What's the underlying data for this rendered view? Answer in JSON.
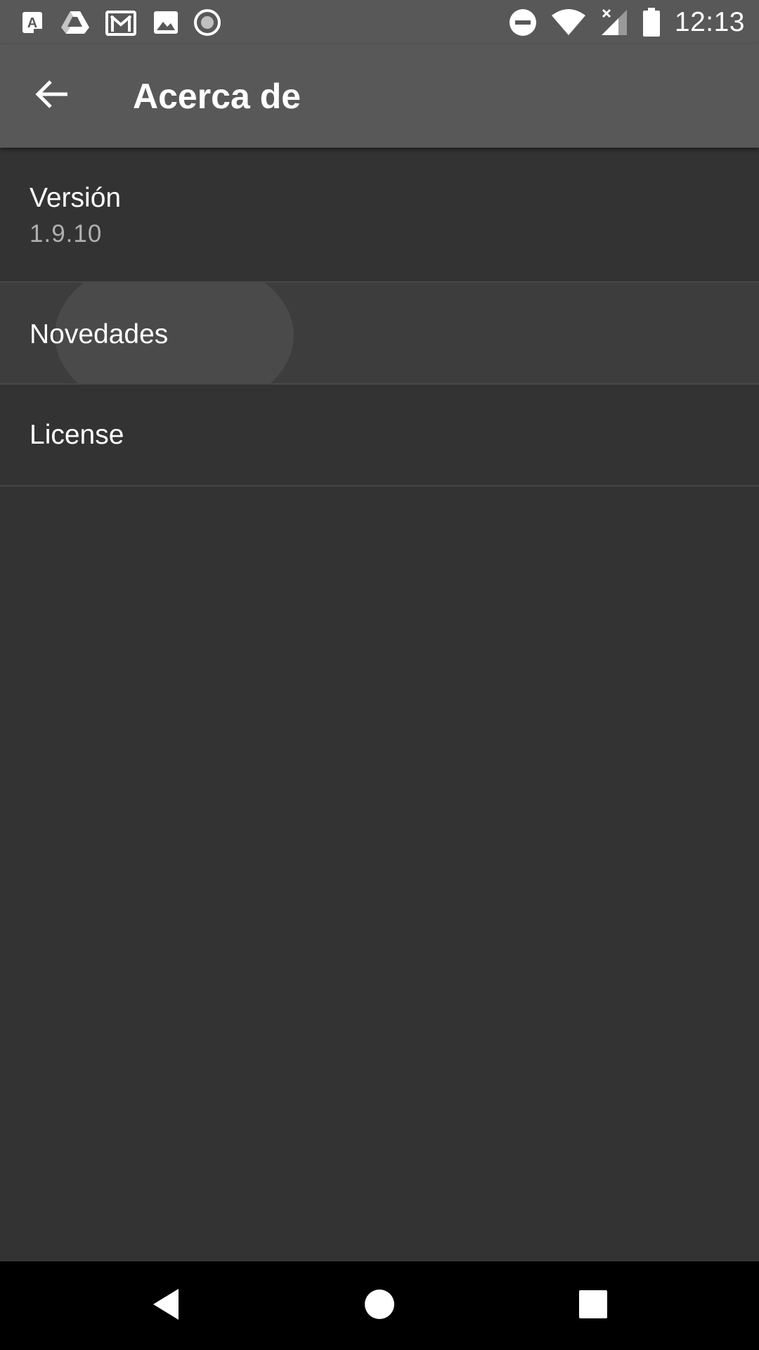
{
  "status_bar": {
    "time": "12:13",
    "notification_icons": [
      "translate-icon",
      "drive-icon",
      "gmail-icon",
      "photos-icon",
      "record-icon"
    ],
    "status_icons": [
      "do-not-disturb-icon",
      "wifi-icon",
      "signal-icon",
      "battery-icon"
    ]
  },
  "app_bar": {
    "title": "Acerca de",
    "back_icon": "arrow-back-icon"
  },
  "items": [
    {
      "title": "Versión",
      "subtitle": "1.9.10"
    },
    {
      "title": "Novedades"
    },
    {
      "title": "License"
    }
  ],
  "nav_bar": {
    "buttons": [
      "back-triangle-icon",
      "home-circle-icon",
      "recents-square-icon"
    ]
  },
  "colors": {
    "background": "#333333",
    "app_bar": "#585858",
    "divider": "#474747",
    "subtitle": "#b0b0b0"
  }
}
